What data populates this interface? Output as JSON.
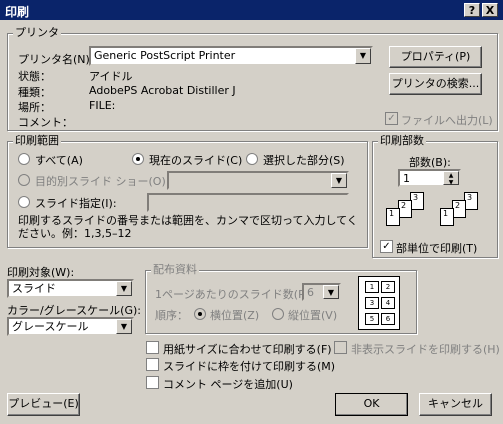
{
  "window": {
    "title": "印刷",
    "help_btn": "?",
    "close_btn": "X"
  },
  "printer": {
    "group_label": "プリンタ",
    "name_label": "プリンタ名(N):",
    "name_value": "Generic PostScript Printer",
    "status_label": "状態：",
    "status_value": "アイドル",
    "type_label": "種類：",
    "type_value": "AdobePS Acrobat Distiller J",
    "location_label": "場所：",
    "location_value": "FILE:",
    "comment_label": "コメント：",
    "properties_btn": "プロパティ(P)",
    "find_btn": "プリンタの検索...",
    "print_to_file": "ファイルへ出力(L)"
  },
  "range": {
    "group_label": "印刷範囲",
    "all": "すべて(A)",
    "current": "現在のスライド(C)",
    "selection": "選択した部分(S)",
    "custom_show": "目的別スライド ショー(O):",
    "slides": "スライド指定(I):",
    "hint": "印刷するスライドの番号または範囲を、カンマで区切って入力してください。例：1,3,5–12"
  },
  "copies": {
    "group_label": "印刷部数",
    "count_label": "部数(B):",
    "count_value": "1",
    "collate": "部単位で印刷(T)"
  },
  "output": {
    "what_label": "印刷対象(W):",
    "what_value": "スライド",
    "color_label": "カラー/グレースケール(G):",
    "color_value": "グレースケール"
  },
  "handouts": {
    "group_label": "配布資料",
    "per_page_label": "1ページあたりのスライド数(R):",
    "per_page_value": "6",
    "order_label": "順序：",
    "horizontal": "横位置(Z)",
    "vertical": "縦位置(V)",
    "preview_numbers": [
      "1",
      "2",
      "3",
      "4",
      "5",
      "6"
    ]
  },
  "options": {
    "fit": "用紙サイズに合わせて印刷する(F)",
    "frame": "スライドに枠を付けて印刷する(M)",
    "comments": "コメント ページを追加(U)",
    "hidden": "非表示スライドを印刷する(H)"
  },
  "buttons": {
    "preview": "プレビュー(E)",
    "ok": "OK",
    "cancel": "キャンセル"
  },
  "collate_icons": {
    "labels": [
      "1",
      "2",
      "3"
    ]
  }
}
